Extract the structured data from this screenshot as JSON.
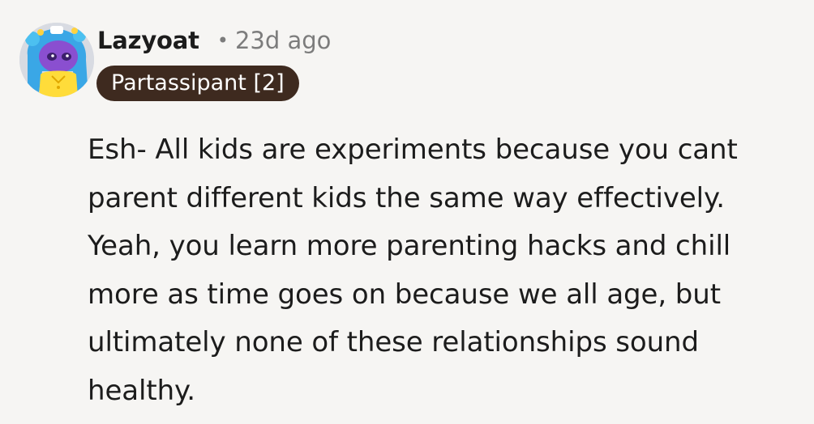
{
  "comment": {
    "author": "Lazyoat",
    "separator": "•",
    "timestamp": "23d ago",
    "flair": "Partassipant [2]",
    "avatar_icon": "snoo-avatar-icon",
    "body_lines": [
      "Esh- All kids are experiments because you cant",
      "parent different kids the same way effectively.",
      "Yeah, you learn more parenting hacks and chill",
      "more as time goes on because we all age, but",
      "ultimately none of these relationships sound",
      "healthy."
    ]
  },
  "colors": {
    "background": "#f6f5f3",
    "flair_background": "#3e2a1f",
    "flair_text": "#ffffff",
    "meta_text": "#7c7c7c"
  }
}
